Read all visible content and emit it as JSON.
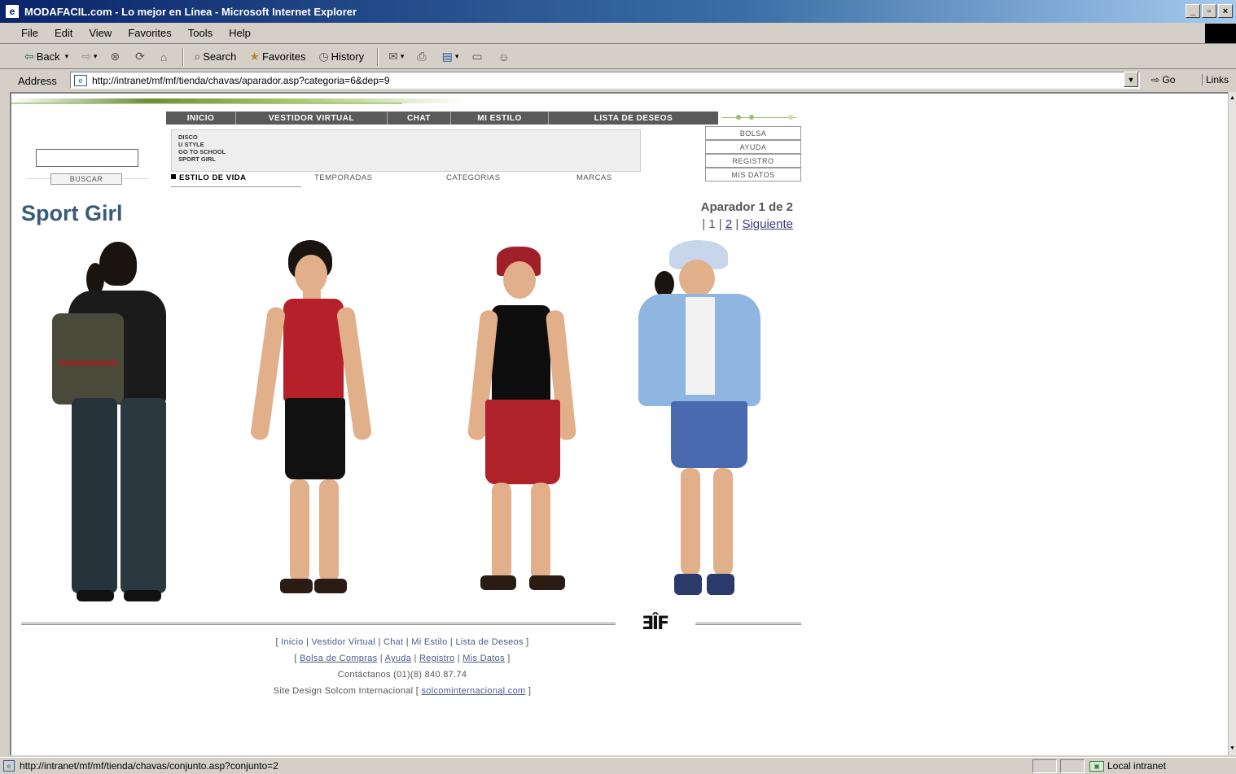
{
  "window": {
    "title": "MODAFACIL.com - Lo mejor en Línea - Microsoft Internet Explorer",
    "controls": [
      "_",
      "▫",
      "×"
    ]
  },
  "menu": [
    "File",
    "Edit",
    "View",
    "Favorites",
    "Tools",
    "Help"
  ],
  "toolbar": {
    "back": "Back",
    "search": "Search",
    "favorites": "Favorites",
    "history": "History"
  },
  "address": {
    "label": "Address",
    "url": "http://intranet/mf/mf/tienda/chavas/aparador.asp?categoria=6&dep=9",
    "go": "Go",
    "links": "Links"
  },
  "nav": [
    "INICIO",
    "VESTIDOR VIRTUAL",
    "CHAT",
    "MI ESTILO",
    "LISTA DE DESEOS"
  ],
  "subcategories": [
    "DISCO",
    "U STYLE",
    "GO TO SCHOOL",
    "SPORT GIRL"
  ],
  "search": {
    "value": "",
    "button": "BUSCAR"
  },
  "tabs": [
    "ESTILO DE VIDA",
    "TEMPORADAS",
    "CATEGORIAS",
    "MARCAS"
  ],
  "side_buttons": [
    "BOLSA",
    "AYUDA",
    "REGISTRO",
    "MIS DATOS"
  ],
  "page": {
    "title": "Sport Girl",
    "aparador": "Aparador 1 de 2",
    "pager_sep1": "| 1 |",
    "pager_page2": "2",
    "pager_sep2": "|",
    "pager_next": "Siguiente"
  },
  "logo": "ƎÎF",
  "footer": {
    "line1": [
      "Inicio",
      "Vestidor Virtual",
      "Chat",
      "Mi Estilo",
      "Lista de Deseos"
    ],
    "line2": [
      "Bolsa de Compras",
      "Ayuda",
      "Registro",
      "Mis Datos"
    ],
    "contact": "Contáctanos (01)(8) 840.87.74",
    "design_prefix": "Site Design Solcom Internacional [",
    "design_link": "solcominternacional.com",
    "design_suffix": "]"
  },
  "status": {
    "url": "http://intranet/mf/mf/tienda/chavas/conjunto.asp?conjunto=2",
    "zone": "Local intranet"
  },
  "colors": {
    "title_blue": "#3a5a7a",
    "nav_gray": "#5a5a5a",
    "accent_green": "#8bb04a"
  }
}
